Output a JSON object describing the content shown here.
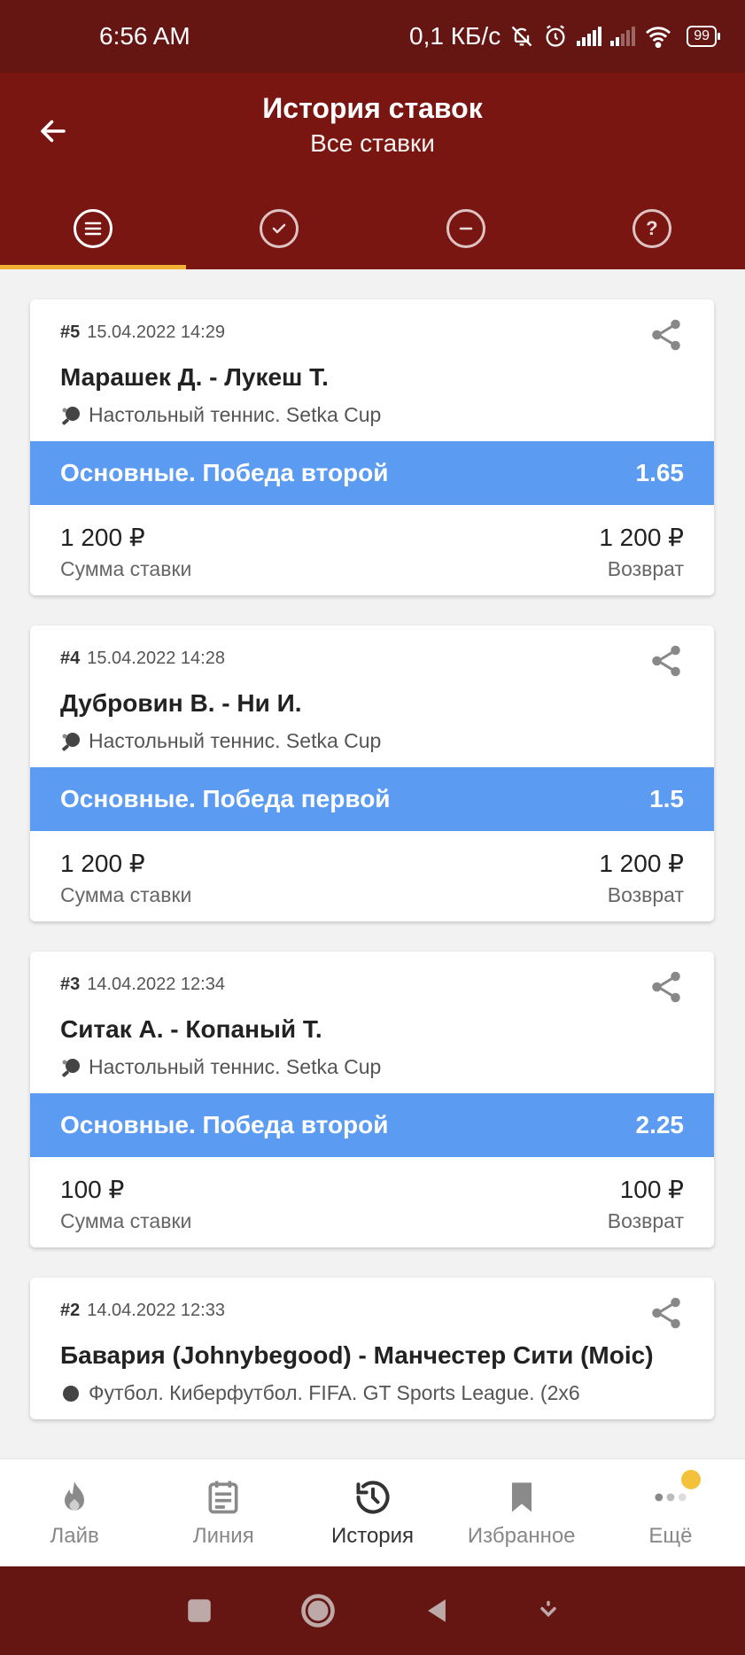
{
  "status": {
    "time": "6:56 AM",
    "speed": "0,1 КБ/с",
    "battery": "99"
  },
  "header": {
    "title": "История ставок",
    "subtitle": "Все ставки"
  },
  "tabs": [
    {
      "name": "all",
      "icon": "list-icon",
      "active": true
    },
    {
      "name": "won",
      "icon": "check-icon",
      "active": false
    },
    {
      "name": "lost",
      "icon": "minus-icon",
      "active": false
    },
    {
      "name": "pending",
      "icon": "question-icon",
      "active": false
    }
  ],
  "bets": [
    {
      "num": "#5",
      "date": "15.04.2022 14:29",
      "teams": "Марашек Д. - Лукеш Т.",
      "sport": "Настольный теннис. Setka Cup",
      "outcome": "Основные. Победа второй",
      "odds": "1.65",
      "stake": "1 200 ₽",
      "stake_label": "Сумма ставки",
      "result": "1 200 ₽",
      "result_label": "Возврат"
    },
    {
      "num": "#4",
      "date": "15.04.2022 14:28",
      "teams": "Дубровин В. - Ни И.",
      "sport": "Настольный теннис. Setka Cup",
      "outcome": "Основные. Победа первой",
      "odds": "1.5",
      "stake": "1 200 ₽",
      "stake_label": "Сумма ставки",
      "result": "1 200 ₽",
      "result_label": "Возврат"
    },
    {
      "num": "#3",
      "date": "14.04.2022 12:34",
      "teams": "Ситак А. - Копаный Т.",
      "sport": "Настольный теннис. Setka Cup",
      "outcome": "Основные. Победа второй",
      "odds": "2.25",
      "stake": "100 ₽",
      "stake_label": "Сумма ставки",
      "result": "100 ₽",
      "result_label": "Возврат"
    },
    {
      "num": "#2",
      "date": "14.04.2022 12:33",
      "teams": "Бавария (Johnybegood) - Манчестер Сити (Moic)",
      "sport": "Футбол. Киберфутбол. FIFA. GT Sports League. (2x6"
    }
  ],
  "bottom_nav": [
    {
      "label": "Лайв",
      "icon": "flame-icon"
    },
    {
      "label": "Линия",
      "icon": "calendar-icon"
    },
    {
      "label": "История",
      "icon": "history-icon",
      "active": true
    },
    {
      "label": "Избранное",
      "icon": "bookmark-icon"
    },
    {
      "label": "Ещё",
      "icon": "more-dots-icon"
    }
  ],
  "colors": {
    "header": "#7a1612",
    "status_bar": "#661612",
    "tab_indicator": "#f2b234",
    "bet_bar": "#5b9cf2",
    "badge": "#f4c23a"
  }
}
